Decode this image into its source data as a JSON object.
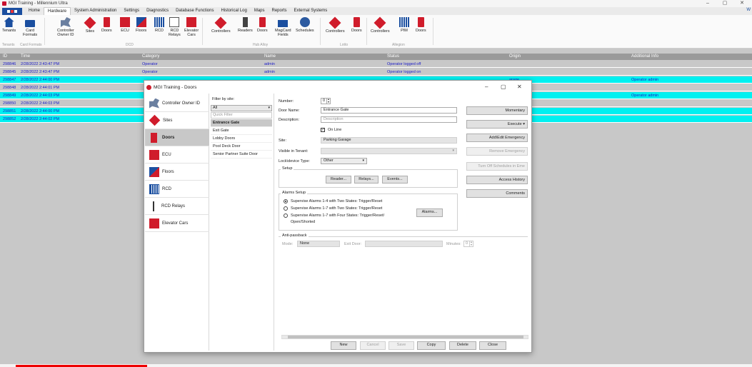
{
  "window": {
    "title": "MGI Training - Millennium Ultra",
    "controls": [
      "–",
      "▢",
      "✕"
    ]
  },
  "menu": {
    "items": [
      "Home",
      "Hardware",
      "System Administration",
      "Settings",
      "Diagnostics",
      "Database Functions",
      "Historical Log",
      "Maps",
      "Reports",
      "External Systems"
    ],
    "active": "Hardware",
    "right": "W"
  },
  "ribbon": {
    "buttons": [
      {
        "label": "Tenants",
        "icon": "house-icon"
      },
      {
        "label": "Card\nFormats",
        "icon": "card-icon"
      },
      {
        "label": "Controller\nOwner ID",
        "icon": "cog-icon"
      },
      {
        "label": "Sites",
        "icon": "diamond-icon"
      },
      {
        "label": "Doors",
        "icon": "door-icon"
      },
      {
        "label": "ECU",
        "icon": "ecu-icon"
      },
      {
        "label": "Floors",
        "icon": "floors-icon"
      },
      {
        "label": "RCD",
        "icon": "rcd-icon"
      },
      {
        "label": "RCD\nRelays",
        "icon": "relay-icon"
      },
      {
        "label": "Elevator\nCars",
        "icon": "elevator-icon"
      },
      {
        "label": "Controllers",
        "icon": "diamond-icon"
      },
      {
        "label": "Readers",
        "icon": "reader-icon"
      },
      {
        "label": "Doors",
        "icon": "door-icon"
      },
      {
        "label": "MagCard\nFields",
        "icon": "magcard-icon"
      },
      {
        "label": "Schedules",
        "icon": "schedule-icon"
      },
      {
        "label": "Controllers",
        "icon": "diamond-icon"
      },
      {
        "label": "Doors",
        "icon": "door-icon"
      },
      {
        "label": "Controllers",
        "icon": "diamond-icon"
      },
      {
        "label": "PIM",
        "icon": "pim-icon"
      },
      {
        "label": "Doors",
        "icon": "door-icon"
      }
    ],
    "groups": [
      "Tenants",
      "Card Formats",
      "DCD",
      "Hub Alloy",
      "Lotto",
      "Allegion"
    ]
  },
  "grid": {
    "columns": [
      "ID",
      "Time",
      "Category",
      "Name",
      "Status",
      "Origin",
      "Additional Info"
    ],
    "rows": [
      {
        "id": "298846",
        "time": "2/28/2022 2:43:47 PM",
        "category": "Operator",
        "name": "admin",
        "status": "Operator logged off",
        "origin": "",
        "info": "",
        "style": "grey"
      },
      {
        "id": "298845",
        "time": "2/28/2022 2:43:47 PM",
        "category": "Operator",
        "name": "admin",
        "status": "Operator logged on",
        "origin": "",
        "info": "",
        "style": "grey"
      },
      {
        "id": "298847",
        "time": "2/28/2022 2:44:00 PM",
        "category": "",
        "name": "",
        "status": "",
        "origin": "arage",
        "info": "Operator admin",
        "style": "cyan"
      },
      {
        "id": "298848",
        "time": "2/28/2022 2:44:01 PM",
        "category": "",
        "name": "",
        "status": "",
        "origin": "arage",
        "info": "",
        "style": "grey"
      },
      {
        "id": "298849",
        "time": "2/28/2022 2:44:03 PM",
        "category": "",
        "name": "",
        "status": "",
        "origin": "arage",
        "info": "Operator admin",
        "style": "cyan"
      },
      {
        "id": "298850",
        "time": "2/28/2022 2:44:03 PM",
        "category": "",
        "name": "",
        "status": "",
        "origin": "arage",
        "info": "",
        "style": "grey"
      },
      {
        "id": "298851",
        "time": "2/28/2022 2:44:00 PM",
        "category": "",
        "name": "",
        "status": "",
        "origin": "",
        "info": "",
        "style": "cyan"
      },
      {
        "id": "298852",
        "time": "2/28/2022 2:44:02 PM",
        "category": "",
        "name": "",
        "status": "",
        "origin": "",
        "info": "",
        "style": "cyan"
      }
    ]
  },
  "dialog": {
    "title": "MGI Training - Doors",
    "controls": [
      "–",
      "▢",
      "✕"
    ],
    "nav": [
      {
        "label": "Controller Owner ID",
        "icon": "cog-icon",
        "selected": false
      },
      {
        "label": "Sites",
        "icon": "diamond-icon",
        "selected": false
      },
      {
        "label": "Doors",
        "icon": "door-icon",
        "selected": true
      },
      {
        "label": "ECU",
        "icon": "ecu-icon",
        "selected": false
      },
      {
        "label": "Floors",
        "icon": "floors-icon",
        "selected": false
      },
      {
        "label": "RCD",
        "icon": "rcd-icon",
        "selected": false
      },
      {
        "label": "RCD Relays",
        "icon": "relay-icon",
        "selected": false
      },
      {
        "label": "Elevator Cars",
        "icon": "elevator-icon",
        "selected": false
      }
    ],
    "filter": {
      "label": "Filter by site:",
      "value": "All",
      "quick_filter_placeholder": "Quick Filter",
      "doors": [
        "Entrance Gate",
        "Exit Gate",
        "Lobby Doors",
        "Pool Deck Door",
        "Senior Partner Suite Door"
      ],
      "selected_index": 0
    },
    "form": {
      "number_label": "Number:",
      "number_value": "0",
      "door_name_label": "Door Name:",
      "door_name_value": "Entrance Gate",
      "description_label": "Description:",
      "description_placeholder": "Description",
      "online_label": "On Line",
      "online_checked": true,
      "site_label": "Site:",
      "site_value": "Parking Garage",
      "visible_tenant_label": "Visible in Tenant:",
      "visible_tenant_value": "",
      "lock_type_label": "Lock\\device Type:",
      "lock_type_value": "Other",
      "setup_title": "Setup",
      "reader_button": "Reader...",
      "relays_button": "Relays...",
      "events_button": "Events...",
      "alarms_title": "Alarms Setup",
      "alarm_options": [
        "Supervise Alarms 1-4 with Two States: Trigger/Reset",
        "Supervise Alarms 1-7 with Two States: Trigger/Reset",
        "Supervise Alarms 1-7 with Four States: Trigger/Reset/",
        "Open/Shorted"
      ],
      "alarm_selected": 0,
      "alarms_button": "Alarms...",
      "antipassback_title": "Anti-passback",
      "mode_label": "Mode:",
      "mode_value": "None",
      "exit_door_label": "Exit Door:",
      "exit_door_value": "",
      "minutes_label": "Minutes:",
      "minutes_value": "0"
    },
    "side_buttons": [
      "Momentary",
      "Execute ▾",
      "Add\\Edit Emergency",
      "Remove Emergency",
      "Turn Off Schedules in Eme",
      "Access History",
      "Comments"
    ],
    "bottom_buttons": [
      "New",
      "Cancel",
      "Save",
      "Copy",
      "Delete",
      "Close"
    ]
  }
}
